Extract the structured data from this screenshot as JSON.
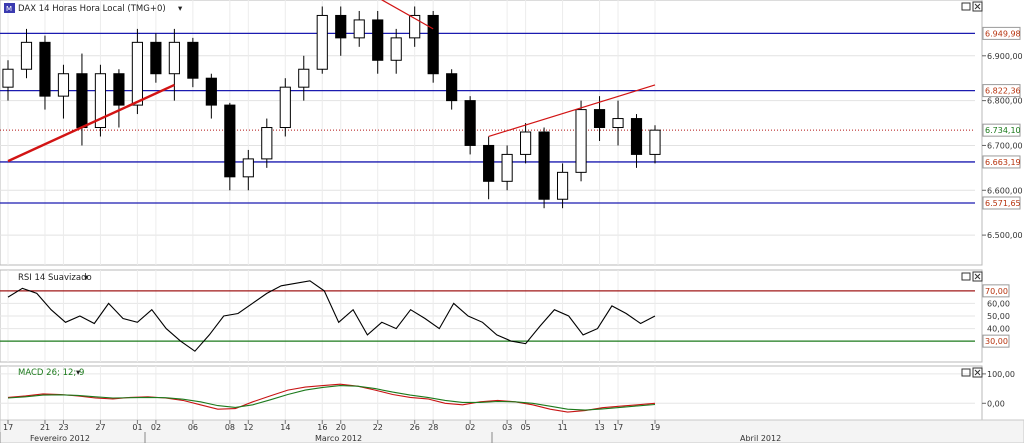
{
  "header": {
    "symbol_badge": "M",
    "price_title": "DAX 14 Horas Hora Local (TMG+0)",
    "rsi_title": "RSI 14 Suavizado",
    "macd_title": "MACD 26; 12; 9"
  },
  "icons": [
    "window-restore-icon",
    "window-close-icon",
    "dropdown-arrow-icon"
  ],
  "colors": {
    "up_candle": "#ffffff",
    "down_candle": "#000000",
    "candle_outline": "#000000",
    "level_line": "#1b1bb0",
    "trend_line": "#d21414",
    "current_price": "#b01010",
    "rsi_line": "#000000",
    "rsi_overbought": "#a01818",
    "rsi_oversold": "#1c7a1c",
    "macd_line": "#1c7a1c",
    "signal_line": "#c81414",
    "tag_text": "#b8340f"
  },
  "chart_data": [
    {
      "type": "candlestick",
      "title": "DAX 14 Horas Hora Local (TMG+0)",
      "ylim": [
        6440,
        7020
      ],
      "y_ticks": [
        "6.900,00",
        "6.800,00",
        "6.700,00",
        "6.600,00",
        "6.500,00"
      ],
      "y_tick_values": [
        6900,
        6800,
        6700,
        6600,
        6500
      ],
      "price_tags": [
        {
          "label": "6.949,98",
          "value": 6949.98
        },
        {
          "label": "6.822,36",
          "value": 6822.36
        },
        {
          "label": "6.734,10",
          "value": 6734.1
        },
        {
          "label": "6.663,19",
          "value": 6663.19
        },
        {
          "label": "6.571,65",
          "value": 6571.65
        }
      ],
      "horizontal_levels": [
        6949.98,
        6822.36,
        6663.19,
        6571.65
      ],
      "current_price": 6734.1,
      "trend_lines": [
        {
          "from": [
            "17 Fev",
            6665
          ],
          "to": [
            "01 Mar",
            6835
          ],
          "width": "thick"
        },
        {
          "from": [
            "17 Fev",
            7030
          ],
          "to": [
            "08 Mar",
            7030
          ],
          "width": "thick"
        },
        {
          "from": [
            "28 Mar",
            7030
          ],
          "to": [
            "02 Abr",
            6960
          ],
          "width": "thin"
        },
        {
          "from": [
            "05 Abr",
            6720
          ],
          "to": [
            "20 Abr",
            6835
          ],
          "width": "thin"
        },
        {
          "from": [
            "12 Abr",
            6545
          ],
          "to": [
            "24 Abr",
            6780
          ],
          "width": "thin"
        }
      ],
      "x_ticks": [
        "17",
        "21",
        "23",
        "27",
        "01",
        "02",
        "06",
        "08",
        "12",
        "14",
        "16",
        "20",
        "22",
        "26",
        "28",
        "02",
        "03",
        "05",
        "11",
        "13",
        "17",
        "19"
      ],
      "x_months": [
        "Fevereiro 2012",
        "Marco 2012",
        "Abril 2012"
      ],
      "candles": [
        {
          "t": "17 Fev",
          "o": 6830,
          "h": 6890,
          "l": 6800,
          "c": 6870
        },
        {
          "t": "20 Fev",
          "o": 6870,
          "h": 6960,
          "l": 6850,
          "c": 6930
        },
        {
          "t": "21 Fev",
          "o": 6930,
          "h": 6945,
          "l": 6780,
          "c": 6810
        },
        {
          "t": "22 Fev",
          "o": 6810,
          "h": 6880,
          "l": 6760,
          "c": 6860
        },
        {
          "t": "23 Fev",
          "o": 6860,
          "h": 6905,
          "l": 6700,
          "c": 6740
        },
        {
          "t": "24 Fev",
          "o": 6740,
          "h": 6880,
          "l": 6720,
          "c": 6860
        },
        {
          "t": "27 Fev",
          "o": 6860,
          "h": 6870,
          "l": 6740,
          "c": 6790
        },
        {
          "t": "28 Fev",
          "o": 6790,
          "h": 6960,
          "l": 6770,
          "c": 6930
        },
        {
          "t": "29 Fev",
          "o": 6930,
          "h": 6950,
          "l": 6840,
          "c": 6860
        },
        {
          "t": "01 Mar",
          "o": 6860,
          "h": 6960,
          "l": 6800,
          "c": 6930
        },
        {
          "t": "02 Mar",
          "o": 6930,
          "h": 6940,
          "l": 6830,
          "c": 6850
        },
        {
          "t": "05 Mar",
          "o": 6850,
          "h": 6860,
          "l": 6760,
          "c": 6790
        },
        {
          "t": "06 Mar",
          "o": 6790,
          "h": 6795,
          "l": 6600,
          "c": 6630
        },
        {
          "t": "07 Mar",
          "o": 6630,
          "h": 6690,
          "l": 6600,
          "c": 6670
        },
        {
          "t": "08 Mar",
          "o": 6670,
          "h": 6760,
          "l": 6650,
          "c": 6740
        },
        {
          "t": "09 Mar",
          "o": 6740,
          "h": 6850,
          "l": 6720,
          "c": 6830
        },
        {
          "t": "12 Mar",
          "o": 6830,
          "h": 6900,
          "l": 6800,
          "c": 6870
        },
        {
          "t": "13 Mar",
          "o": 6870,
          "h": 7010,
          "l": 6860,
          "c": 6990
        },
        {
          "t": "26 Mar",
          "o": 6990,
          "h": 7010,
          "l": 6900,
          "c": 6940
        },
        {
          "t": "27 Mar",
          "o": 6940,
          "h": 7000,
          "l": 6920,
          "c": 6980
        },
        {
          "t": "28 Mar",
          "o": 6980,
          "h": 7000,
          "l": 6860,
          "c": 6890
        },
        {
          "t": "29 Mar",
          "o": 6890,
          "h": 6960,
          "l": 6860,
          "c": 6940
        },
        {
          "t": "30 Mar",
          "o": 6940,
          "h": 7010,
          "l": 6920,
          "c": 6990
        },
        {
          "t": "02 Abr",
          "o": 6990,
          "h": 7000,
          "l": 6840,
          "c": 6860
        },
        {
          "t": "03 Abr",
          "o": 6860,
          "h": 6870,
          "l": 6780,
          "c": 6800
        },
        {
          "t": "04 Abr",
          "o": 6800,
          "h": 6810,
          "l": 6680,
          "c": 6700
        },
        {
          "t": "05 Abr",
          "o": 6700,
          "h": 6720,
          "l": 6580,
          "c": 6620
        },
        {
          "t": "10 Abr",
          "o": 6620,
          "h": 6700,
          "l": 6600,
          "c": 6680
        },
        {
          "t": "11 Abr",
          "o": 6680,
          "h": 6750,
          "l": 6660,
          "c": 6730
        },
        {
          "t": "12 Abr",
          "o": 6730,
          "h": 6740,
          "l": 6560,
          "c": 6580
        },
        {
          "t": "13 Abr",
          "o": 6580,
          "h": 6660,
          "l": 6560,
          "c": 6640
        },
        {
          "t": "16 Abr",
          "o": 6640,
          "h": 6800,
          "l": 6620,
          "c": 6780
        },
        {
          "t": "17 Abr",
          "o": 6780,
          "h": 6810,
          "l": 6710,
          "c": 6740
        },
        {
          "t": "18 Abr",
          "o": 6740,
          "h": 6800,
          "l": 6700,
          "c": 6760
        },
        {
          "t": "19 Abr",
          "o": 6760,
          "h": 6770,
          "l": 6650,
          "c": 6680
        },
        {
          "t": "20 Abr",
          "o": 6680,
          "h": 6745,
          "l": 6660,
          "c": 6734.1
        }
      ]
    },
    {
      "type": "line",
      "title": "RSI 14 Suavizado",
      "ylim": [
        15,
        85
      ],
      "y_ticks": [
        "60,00",
        "50,00",
        "40,00"
      ],
      "y_tick_values": [
        60,
        50,
        40
      ],
      "levels": [
        {
          "label": "70,00",
          "value": 70
        },
        {
          "label": "30,00",
          "value": 30
        }
      ],
      "series": [
        {
          "values": [
            65,
            72,
            68,
            55,
            45,
            50,
            44,
            60,
            48,
            45,
            55,
            40,
            30,
            22,
            35,
            50,
            52,
            60,
            68,
            74,
            76,
            78,
            70,
            45,
            55,
            35,
            45,
            40,
            55,
            48,
            40,
            60,
            50,
            45,
            35,
            30,
            28,
            42,
            55,
            50,
            35,
            40,
            58,
            52,
            44,
            50
          ]
        }
      ]
    },
    {
      "type": "line",
      "title": "MACD 26; 12; 9",
      "ylim": [
        -50,
        120
      ],
      "y_ticks": [
        "100,00",
        "0,00"
      ],
      "y_tick_values": [
        100,
        0
      ],
      "series": [
        {
          "values": [
            20,
            25,
            32,
            30,
            25,
            18,
            15,
            20,
            22,
            18,
            10,
            -5,
            -20,
            -18,
            5,
            25,
            45,
            55,
            60,
            65,
            58,
            45,
            30,
            20,
            15,
            0,
            -5,
            5,
            10,
            5,
            -5,
            -20,
            -30,
            -25,
            -15,
            -10,
            -5,
            0
          ]
        },
        {
          "values": [
            18,
            22,
            28,
            29,
            27,
            22,
            18,
            19,
            20,
            19,
            14,
            5,
            -8,
            -14,
            -5,
            12,
            30,
            45,
            54,
            60,
            58,
            50,
            38,
            28,
            20,
            10,
            3,
            3,
            6,
            5,
            0,
            -10,
            -20,
            -23,
            -19,
            -14,
            -9,
            -4
          ]
        }
      ]
    }
  ]
}
